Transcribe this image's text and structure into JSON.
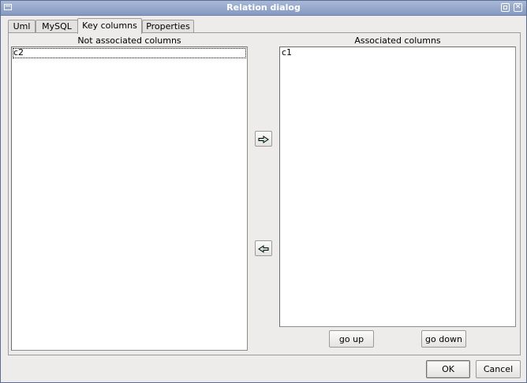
{
  "window": {
    "title": "Relation dialog"
  },
  "tabs": [
    {
      "label": "Uml"
    },
    {
      "label": "MySQL"
    },
    {
      "label": "Key columns"
    },
    {
      "label": "Properties"
    }
  ],
  "active_tab": "Key columns",
  "not_associated": {
    "label": "Not associated columns",
    "items": [
      "c2"
    ]
  },
  "associated": {
    "label": "Associated columns",
    "items": [
      "c1"
    ]
  },
  "buttons": {
    "move_right_icon": "arrow-right-icon",
    "move_left_icon": "arrow-left-icon",
    "go_up": "go up",
    "go_down": "go down",
    "ok": "OK",
    "cancel": "Cancel"
  },
  "colors": {
    "titlebar": "#8599c0",
    "arrow_fill": "#c8e6e0"
  }
}
